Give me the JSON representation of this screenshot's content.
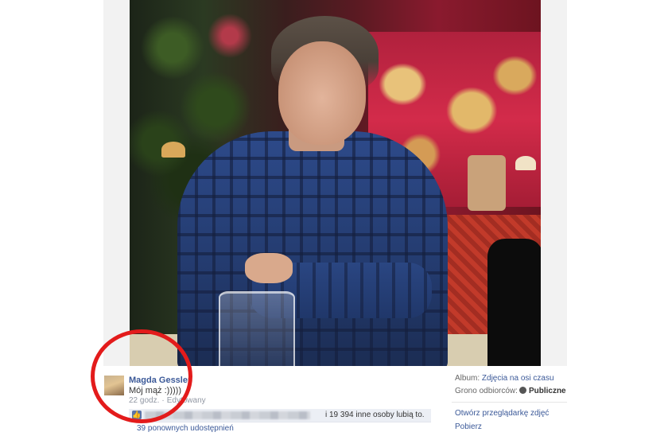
{
  "post": {
    "author_name": "Magda Gessler",
    "text": "Mój mąż :)))))",
    "time": "22 godz.",
    "edited_label": "Edytowany",
    "separator": "·"
  },
  "likes": {
    "summary": "i 19 394 inne osoby lubią to.",
    "shares": "39 ponownych udostępnień"
  },
  "sidebar": {
    "album_label": "Album:",
    "album_value": "Zdjęcia na osi czasu",
    "audience_label": "Grono odbiorców:",
    "audience_value": "Publiczne",
    "actions": [
      "Otwórz przeglądarkę zdjęć",
      "Pobierz"
    ]
  },
  "colors": {
    "link": "#3b5998",
    "annotation": "#e31b1b"
  },
  "icons": {
    "like": "thumbs-up-icon",
    "audience": "globe-icon"
  }
}
